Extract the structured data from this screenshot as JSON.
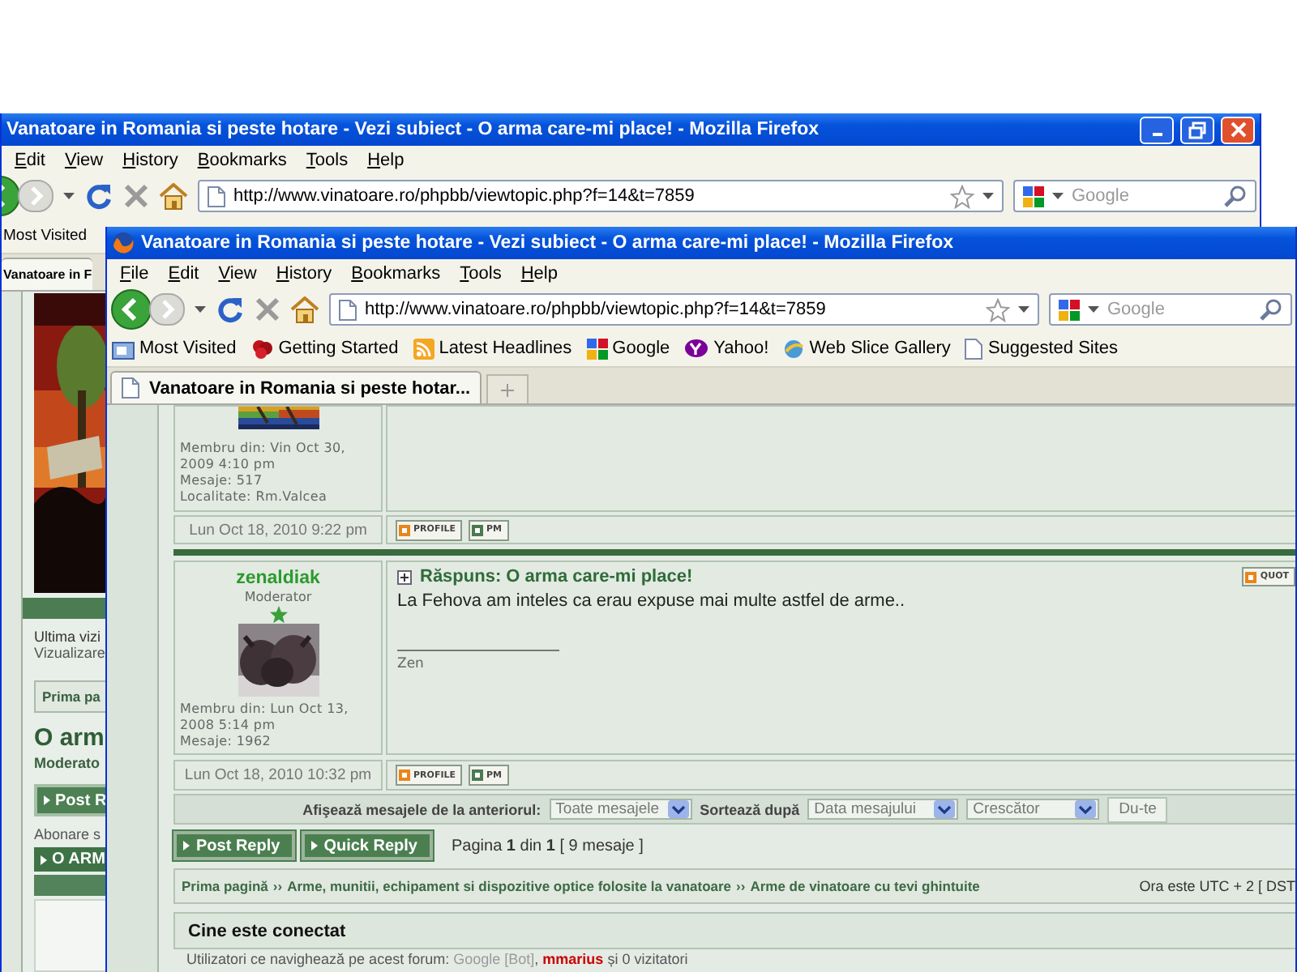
{
  "back_window": {
    "title": "Vanatoare in Romania si peste hotare - Vezi subiect - O arma care-mi place! - Mozilla Firefox",
    "window_controls": true,
    "menu": [
      "Edit",
      "View",
      "History",
      "Bookmarks",
      "Tools",
      "Help"
    ],
    "address": "http://www.vinatoare.ro/phpbb/viewtopic.php?f=14&t=7859",
    "search_placeholder": "Google",
    "bookmarks": [
      {
        "label": "Most Visited"
      }
    ],
    "tabs": [
      {
        "label": "Vanatoare in F",
        "selected": true
      }
    ],
    "page": {
      "last_visit": "Ultima vizi",
      "view_text": "Vizualizare",
      "breadcrumb": "Prima pa",
      "topic_title": "O arm",
      "moderators": "Moderato",
      "post_reply": "Post R",
      "subscribe": "Abonare s",
      "topic_bar": "O ARM"
    }
  },
  "front_window": {
    "title": "Vanatoare in Romania si peste hotare - Vezi subiect - O arma care-mi place! - Mozilla Firefox",
    "app_icon": true,
    "menu": [
      "File",
      "Edit",
      "View",
      "History",
      "Bookmarks",
      "Tools",
      "Help"
    ],
    "address": "http://www.vinatoare.ro/phpbb/viewtopic.php?f=14&t=7859",
    "search_placeholder": "Google",
    "bookmarks": [
      {
        "label": "Most Visited",
        "kind": "folder"
      },
      {
        "label": "Getting Started",
        "kind": "flower"
      },
      {
        "label": "Latest Headlines",
        "kind": "feed"
      },
      {
        "label": "Google",
        "kind": "squares"
      },
      {
        "label": "Yahoo!",
        "kind": "badge"
      },
      {
        "label": "Web Slice Gallery",
        "kind": "globe"
      },
      {
        "label": "Suggested Sites",
        "kind": "page"
      }
    ],
    "tabs": [
      {
        "label": "Vanatoare in Romania si peste hotar...",
        "selected": true
      }
    ],
    "posts": [
      {
        "member_since": "Membru din: Vin Oct 30, 2009 4:10 pm",
        "post_count": "Mesaje: 517",
        "location": "Localitate: Rm.Valcea",
        "date": "Lun Oct 18, 2010 9:22 pm",
        "buttons": [
          "PROFILE",
          "PM"
        ]
      },
      {
        "author": "zenaldiak",
        "rank": "Moderator",
        "subject": "Răspuns: O arma care-mi place!",
        "quote_button": "QUOT",
        "body": "La Fehova am inteles ca erau expuse mai multe astfel de arme..",
        "signature": "Zen",
        "member_since": "Membru din: Lun Oct 13, 2008 5:14 pm",
        "post_count": "Mesaje: 1962",
        "date": "Lun Oct 18, 2010 10:32 pm",
        "buttons": [
          "PROFILE",
          "PM"
        ]
      }
    ],
    "sort_bar": {
      "label": "Afişează mesajele de la anteriorul:",
      "days": "Toate mesajele",
      "sort_label": "Sortează după",
      "sort_key": "Data mesajului",
      "direction": "Crescător",
      "go": "Du-te"
    },
    "actions": [
      "Post Reply",
      "Quick Reply"
    ],
    "pagination": "Pagina **1** din **1**  [ 9 mesaje ]",
    "breadcrumb": {
      "links": [
        "Prima pagină",
        "Arme, munitii, echipament si dispozitive optice folosite la vanatoare",
        "Arme de vinatoare cu tevi ghintuite"
      ],
      "separators": [
        "››",
        "››"
      ],
      "timezone": "Ora este UTC + 2 [ DST"
    },
    "who_is_online": {
      "title": "Cine este conectat",
      "prefix": "Utilizatori ce navighează pe acest forum:",
      "users": [
        {
          "name": "Google [Bot]",
          "color": "#9a9a9a"
        },
        {
          "name": "mmarius",
          "color": "#cc0000"
        }
      ],
      "user_separator": ",",
      "suffix": "și 0 vizitatori"
    }
  }
}
